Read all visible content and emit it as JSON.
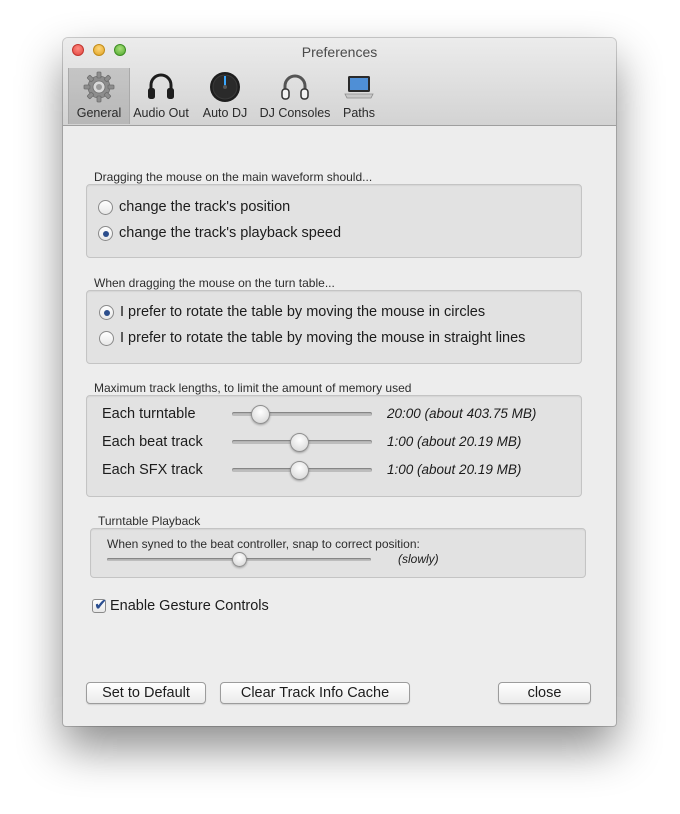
{
  "window": {
    "title": "Preferences"
  },
  "toolbar": {
    "items": [
      {
        "label": "General",
        "icon": "gear-icon",
        "selected": true
      },
      {
        "label": "Audio Out",
        "icon": "headphones-icon",
        "selected": false
      },
      {
        "label": "Auto DJ",
        "icon": "auto-dj-knob-icon",
        "selected": false
      },
      {
        "label": "DJ Consoles",
        "icon": "dj-console-headphones-icon",
        "selected": false
      },
      {
        "label": "Paths",
        "icon": "laptop-icon",
        "selected": false
      }
    ]
  },
  "waveform_group": {
    "label": "Dragging the mouse on the main waveform should...",
    "options": [
      {
        "label": "change the track's position",
        "selected": false
      },
      {
        "label": "change the track's playback speed",
        "selected": true
      }
    ]
  },
  "turntable_group": {
    "label": "When dragging the mouse on the turn table...",
    "options": [
      {
        "label": "I prefer to rotate the table by moving the mouse in circles",
        "selected": true
      },
      {
        "label": "I prefer to rotate the table by moving the mouse in straight lines",
        "selected": false
      }
    ]
  },
  "track_lengths_group": {
    "label": "Maximum track lengths, to limit the amount of memory used",
    "sliders": [
      {
        "label": "Each turntable",
        "value_text": "20:00 (about 403.75 MB)",
        "position": 0.2
      },
      {
        "label": "Each beat track",
        "value_text": "1:00 (about 20.19 MB)",
        "position": 0.48
      },
      {
        "label": "Each SFX track",
        "value_text": "1:00 (about 20.19 MB)",
        "position": 0.48
      }
    ]
  },
  "playback_group": {
    "label": "Turntable Playback",
    "description": "When syned to the beat controller, snap to correct position:",
    "slider_value_text": "(slowly)",
    "slider_position": 0.5
  },
  "gesture": {
    "label": "Enable Gesture Controls",
    "checked": true
  },
  "buttons": {
    "default_label": "Set to Default",
    "clear_cache_label": "Clear Track Info Cache",
    "close_label": "close"
  },
  "colors": {
    "window_bg": "#ededed",
    "group_bg": "#e2e2e2",
    "radio_dot": "#2c4e8c"
  }
}
